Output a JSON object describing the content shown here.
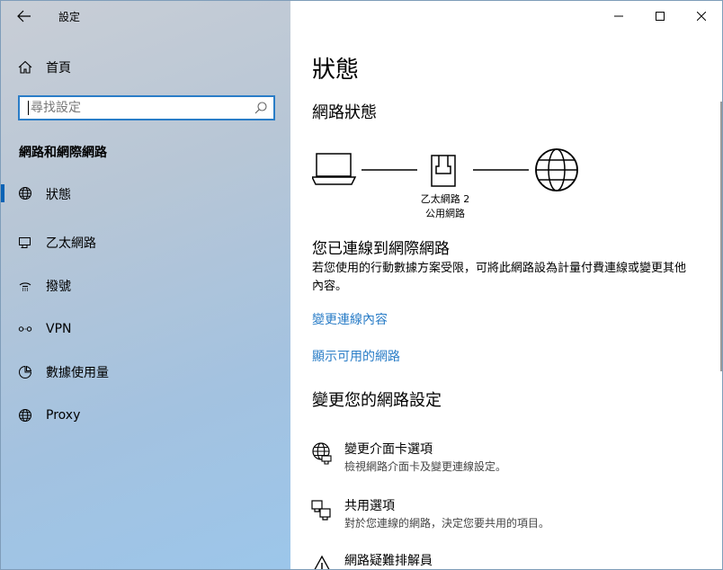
{
  "window": {
    "title": "設定"
  },
  "sidebar": {
    "home_label": "首頁",
    "search_placeholder": "尋找設定",
    "section_title": "網路和網際網路",
    "items": [
      {
        "label": "狀態",
        "icon": "globe-icon",
        "active": true
      },
      {
        "label": "乙太網路",
        "icon": "ethernet-icon"
      },
      {
        "label": "撥號",
        "icon": "dialup-icon"
      },
      {
        "label": "VPN",
        "icon": "vpn-icon"
      },
      {
        "label": "數據使用量",
        "icon": "data-usage-icon"
      },
      {
        "label": "Proxy",
        "icon": "globe-icon"
      }
    ]
  },
  "main": {
    "page_title": "狀態",
    "network_status_heading": "網路狀態",
    "adapter_name": "乙太網路 2",
    "network_type": "公用網路",
    "connected_title": "您已連線到網際網路",
    "connected_desc": "若您使用的行動數據方案受限，可將此網路設為計量付費連線或變更其他內容。",
    "link_change_properties": "變更連線內容",
    "link_show_networks": "顯示可用的網路",
    "change_settings_heading": "變更您的網路設定",
    "options": [
      {
        "title": "變更介面卡選項",
        "desc": "檢視網路介面卡及變更連線設定。",
        "icon": "adapter-globe-icon"
      },
      {
        "title": "共用選項",
        "desc": "對於您連線的網路，決定您要共用的項目。",
        "icon": "sharing-icon"
      },
      {
        "title": "網路疑難排解員",
        "desc": "",
        "icon": "warning-icon"
      }
    ]
  }
}
